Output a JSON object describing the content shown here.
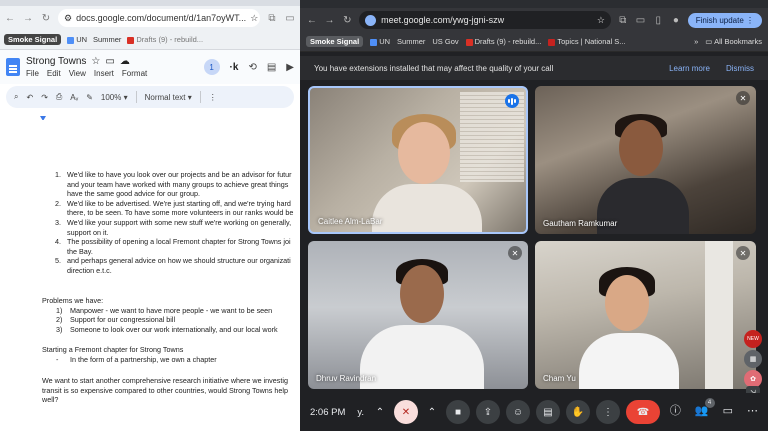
{
  "docs": {
    "url": "docs.google.com/document/d/1an7oyWT...",
    "bookmarks": {
      "smoke_signal": "Smoke Signal",
      "un": "UN",
      "summer": "Summer",
      "drafts": "Drafts (9) - rebuild..."
    },
    "title": "Strong Towns",
    "menus": [
      "File",
      "Edit",
      "View",
      "Insert",
      "Format"
    ],
    "avatar_initial": "1",
    "zoom": "100%",
    "style": "Normal text",
    "list_items": [
      {
        "num": "1.",
        "lines": [
          "We'd like to have you look over our projects and be an advisor for futur",
          "and your team have worked with many groups to achieve great things",
          "have the same good advice for our group."
        ]
      },
      {
        "num": "2.",
        "lines": [
          "We'd like to be advertised. We're just starting off, and we're trying hard",
          "there, to be seen. To have some more volunteers in our ranks would be"
        ]
      },
      {
        "num": "3.",
        "lines": [
          "We'd like your support with some new stuff we're working on generally,",
          "support on it."
        ]
      },
      {
        "num": "4.",
        "lines": [
          "The possibility of opening a local Fremont chapter for Strong Towns joi",
          "the Bay."
        ]
      },
      {
        "num": "5.",
        "lines": [
          "and perhaps general advice on how we should structure our organizati",
          "direction e.t.c."
        ]
      }
    ],
    "problems_heading": "Problems we have:",
    "problems": [
      {
        "num": "1)",
        "text": "Manpower - we want to have more people - we want to be seen"
      },
      {
        "num": "2)",
        "text": "Support for our congressional bill"
      },
      {
        "num": "3)",
        "text": "Someone to look over our work internationally, and our local work"
      }
    ],
    "chapter_heading": "Starting a Fremont chapter for Strong Towns",
    "chapter_item": {
      "num": "-",
      "text": "In the form of a partnership, we own a chapter"
    },
    "research_lines": [
      "We want to start another comprehensive research initiative where we investig",
      "transit is so expensive compared to other countries, would Strong Towns help",
      "well?"
    ]
  },
  "meet": {
    "url": "meet.google.com/ywg-jgni-szw",
    "finish_update": "Finish update",
    "bookmarks": {
      "smoke_signal": "Smoke Signal",
      "un": "UN",
      "summer": "Summer",
      "us_gov": "US Gov",
      "drafts": "Drafts (9) - rebuild...",
      "topics": "Topics | National S...",
      "all_bookmarks": "All Bookmarks"
    },
    "banner": {
      "text": "You have extensions installed that may affect the quality of your call",
      "learn_more": "Learn more",
      "dismiss": "Dismiss"
    },
    "participants": [
      {
        "name": "Caitlee Alm-LaBar"
      },
      {
        "name": "Gautham Ramkumar"
      },
      {
        "name": "Dhruv Ravindran"
      },
      {
        "name": "Cham Yu"
      }
    ],
    "time": "2:06 PM",
    "meeting_code": "y.",
    "people_count": "4",
    "new_label": "NEW"
  },
  "colors": {
    "meet_bg": "#202124",
    "end_call": "#ea4335",
    "accent": "#8ab4f8",
    "active_border": "#a8c7fa"
  }
}
